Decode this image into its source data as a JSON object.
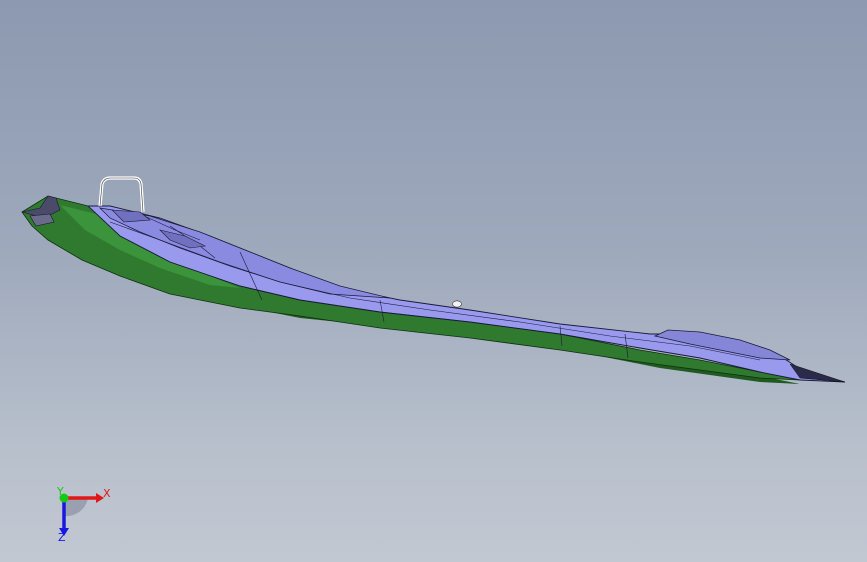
{
  "viewport": {
    "background_top": "#8c99b0",
    "background_bottom": "#c2c8d2"
  },
  "model": {
    "top_surface_color": "#9999ee",
    "side_surface_color": "#2f7a2f",
    "underside_color": "#1f5a1f",
    "edge_color": "#1a1a3a",
    "handle_color": "#ffffff"
  },
  "triad": {
    "x_label": "X",
    "y_label": "Y",
    "z_label": "Z",
    "x_color": "#e01818",
    "y_color": "#18c818",
    "z_color": "#1818e0"
  }
}
